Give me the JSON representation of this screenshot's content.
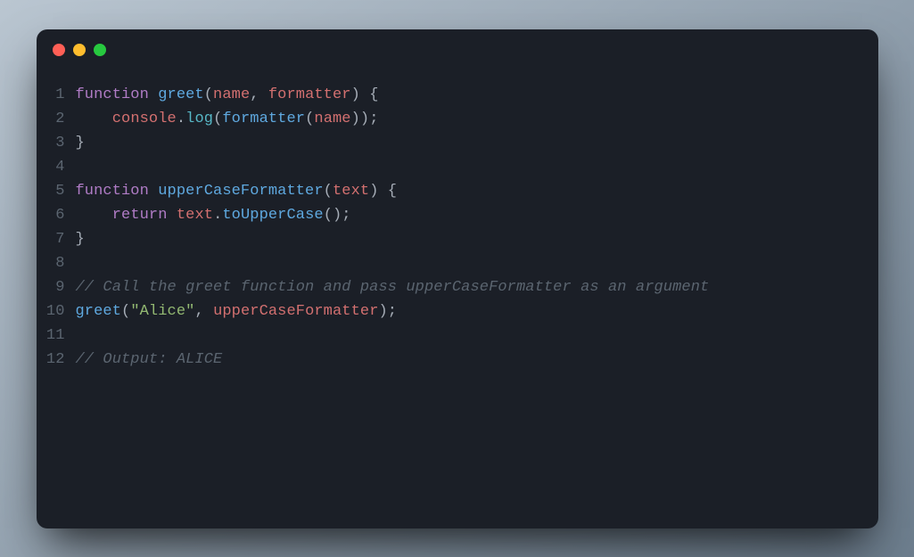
{
  "window": {
    "dots": [
      "red",
      "yellow",
      "green"
    ]
  },
  "code": {
    "lines": [
      {
        "n": "1",
        "tokens": [
          {
            "cls": "tok-keyword",
            "t": "function "
          },
          {
            "cls": "tok-func",
            "t": "greet"
          },
          {
            "cls": "tok-punct",
            "t": "("
          },
          {
            "cls": "tok-ident",
            "t": "name"
          },
          {
            "cls": "tok-punct",
            "t": ", "
          },
          {
            "cls": "tok-ident",
            "t": "formatter"
          },
          {
            "cls": "tok-punct",
            "t": ") {"
          }
        ]
      },
      {
        "n": "2",
        "tokens": [
          {
            "cls": "tok-default",
            "t": "    "
          },
          {
            "cls": "tok-ident",
            "t": "console"
          },
          {
            "cls": "tok-punct",
            "t": "."
          },
          {
            "cls": "tok-member",
            "t": "log"
          },
          {
            "cls": "tok-punct",
            "t": "("
          },
          {
            "cls": "tok-func",
            "t": "formatter"
          },
          {
            "cls": "tok-punct",
            "t": "("
          },
          {
            "cls": "tok-ident",
            "t": "name"
          },
          {
            "cls": "tok-punct",
            "t": "));"
          }
        ]
      },
      {
        "n": "3",
        "tokens": [
          {
            "cls": "tok-punct",
            "t": "}"
          }
        ]
      },
      {
        "n": "4",
        "tokens": [
          {
            "cls": "tok-default",
            "t": ""
          }
        ]
      },
      {
        "n": "5",
        "tokens": [
          {
            "cls": "tok-keyword",
            "t": "function "
          },
          {
            "cls": "tok-func",
            "t": "upperCaseFormatter"
          },
          {
            "cls": "tok-punct",
            "t": "("
          },
          {
            "cls": "tok-ident",
            "t": "text"
          },
          {
            "cls": "tok-punct",
            "t": ") {"
          }
        ]
      },
      {
        "n": "6",
        "tokens": [
          {
            "cls": "tok-default",
            "t": "    "
          },
          {
            "cls": "tok-keyword",
            "t": "return "
          },
          {
            "cls": "tok-ident",
            "t": "text"
          },
          {
            "cls": "tok-punct",
            "t": "."
          },
          {
            "cls": "tok-func",
            "t": "toUpperCase"
          },
          {
            "cls": "tok-punct",
            "t": "();"
          }
        ]
      },
      {
        "n": "7",
        "tokens": [
          {
            "cls": "tok-punct",
            "t": "}"
          }
        ]
      },
      {
        "n": "8",
        "tokens": [
          {
            "cls": "tok-default",
            "t": ""
          }
        ]
      },
      {
        "n": "9",
        "tokens": [
          {
            "cls": "tok-comment",
            "t": "// Call the greet function and pass upperCaseFormatter as an argument"
          }
        ]
      },
      {
        "n": "10",
        "tokens": [
          {
            "cls": "tok-func",
            "t": "greet"
          },
          {
            "cls": "tok-punct",
            "t": "("
          },
          {
            "cls": "tok-string",
            "t": "\"Alice\""
          },
          {
            "cls": "tok-punct",
            "t": ", "
          },
          {
            "cls": "tok-ident",
            "t": "upperCaseFormatter"
          },
          {
            "cls": "tok-punct",
            "t": ");"
          }
        ]
      },
      {
        "n": "11",
        "tokens": [
          {
            "cls": "tok-default",
            "t": ""
          }
        ]
      },
      {
        "n": "12",
        "tokens": [
          {
            "cls": "tok-comment",
            "t": "// Output: ALICE"
          }
        ]
      }
    ]
  }
}
